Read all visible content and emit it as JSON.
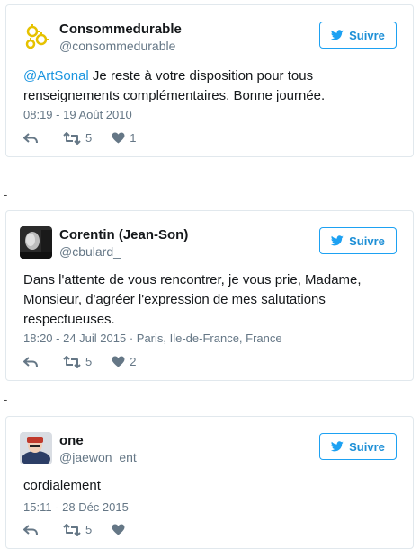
{
  "separator": "-",
  "follow_label": "Suivre",
  "tweets": [
    {
      "name": "Consommedurable",
      "handle": "@consommedurable",
      "mention": "@ArtSonal",
      "text": " Je reste à votre disposition pour tous renseignements complémentaires. Bonne journée.",
      "time": "08:19 - 19 Août 2010",
      "location": "",
      "retweets": "5",
      "likes": "1"
    },
    {
      "name": "Corentin (Jean-Son)",
      "handle": "@cbulard_",
      "mention": "",
      "text": "Dans l'attente de vous rencontrer, je vous prie, Madame, Monsieur, d'agréer l'expression de mes salutations respectueuses.",
      "time": "18:20 - 24 Juil 2015",
      "location": "· Paris, Ile-de-France, France",
      "retweets": "5",
      "likes": "2"
    },
    {
      "name": "one",
      "handle": "@jaewon_ent",
      "mention": "",
      "text": "cordialement",
      "time": "15:11 - 28 Déc 2015",
      "location": "",
      "retweets": "5",
      "likes": ""
    }
  ],
  "colors": {
    "twitter_blue": "#1da1f2",
    "mention": "#1b95e0",
    "muted": "#657786",
    "border": "#e1e8ed"
  },
  "icons": [
    "reply-icon",
    "retweet-icon",
    "heart-icon",
    "twitter-bird-icon"
  ]
}
